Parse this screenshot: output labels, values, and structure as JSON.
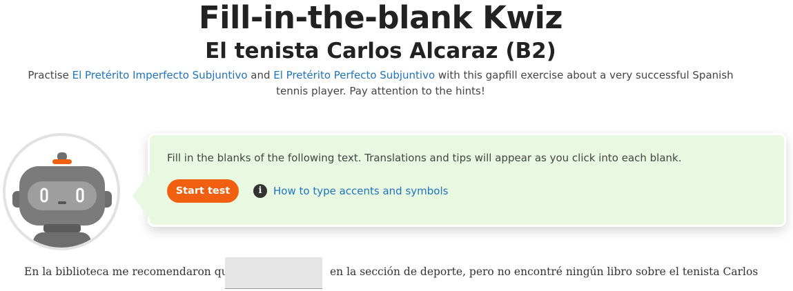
{
  "header": {
    "title": "Fill-in-the-blank Kwiz",
    "subtitle": "El tenista Carlos Alcaraz (B2)"
  },
  "intro": {
    "prefix": "Practise ",
    "link1": "El Pretérito Imperfecto Subjuntivo",
    "middle": " and ",
    "link2": "El Pretérito Perfecto Subjuntivo",
    "suffix": " with this gapfill exercise about a very successful Spanish tennis player. Pay attention to the hints!"
  },
  "instructions": {
    "text": "Fill in the blanks of the following text. Translations and tips will appear as you click into each blank.",
    "start_button": "Start test",
    "info_icon": "info-icon",
    "accents_link": "How to type accents and symbols"
  },
  "exercise": {
    "before_blank": "En la biblioteca me recomendaron que",
    "blank_value": "",
    "after_blank": "en la sección de deporte, pero no encontré ningún libro sobre el tenista Carlos"
  },
  "colors": {
    "accent": "#f06010",
    "link": "#1e73be",
    "bubble_bg": "#e9f9e1",
    "blank_bg": "#e5e5e5"
  }
}
